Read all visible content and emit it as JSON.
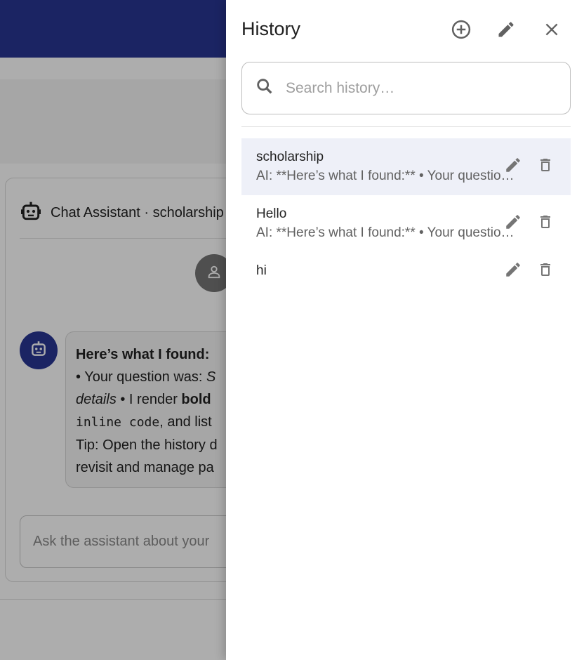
{
  "chat": {
    "title": "Chat Assistant · scholarship",
    "message": {
      "heading": "Here’s what I found:",
      "line1_prefix": "• Your question was: ",
      "line1_italic": "S",
      "line2_italic": "details",
      "line2_mid": " • I render ",
      "line2_bold": "bold",
      "line3_code": "inline code",
      "line3_rest": ", and list",
      "line4": "Tip: Open the history d",
      "line5": "revisit and manage pa"
    },
    "input_placeholder": "Ask the assistant about your"
  },
  "drawer": {
    "title": "History",
    "actions": {
      "new": "add-circle-icon",
      "edit": "pencil-icon",
      "close": "close-icon"
    },
    "search_placeholder": "Search history…",
    "items": [
      {
        "title": "scholarship",
        "preview": "AI: **Here’s what I found:** • Your question was: scholarship",
        "active": true
      },
      {
        "title": "Hello",
        "preview": "AI: **Here’s what I found:** • Your question was: Hello",
        "active": false
      },
      {
        "title": "hi",
        "preview": "",
        "active": false
      }
    ]
  },
  "colors": {
    "brand": "#283593",
    "active_row": "#eef0f8"
  }
}
